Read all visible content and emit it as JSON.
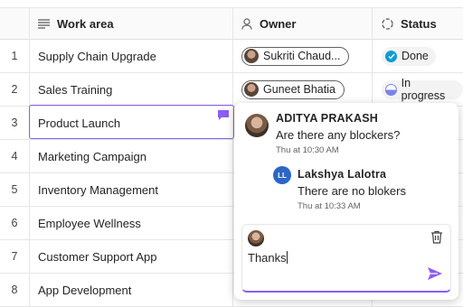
{
  "header": {
    "work_area": "Work area",
    "owner": "Owner",
    "status": "Status"
  },
  "rows": [
    {
      "num": "1",
      "work": "Supply Chain Upgrade",
      "owner": "Sukriti Chaud...",
      "status": "Done"
    },
    {
      "num": "2",
      "work": "Sales Training",
      "owner": "Guneet Bhatia",
      "status": "In progress"
    },
    {
      "num": "3",
      "work": "Product Launch"
    },
    {
      "num": "4",
      "work": "Marketing Campaign"
    },
    {
      "num": "5",
      "work": "Inventory Management"
    },
    {
      "num": "6",
      "work": "Employee Wellness"
    },
    {
      "num": "7",
      "work": "Customer Support App"
    },
    {
      "num": "8",
      "work": "App Development"
    }
  ],
  "comments": [
    {
      "author": "ADITYA PRAKASH",
      "text": "Are there any blockers?",
      "time": "Thu at 10:30 AM"
    },
    {
      "author": "Lakshya Lalotra",
      "initials": "LL",
      "text": "There are no blokers",
      "time": "Thu at 10:33 AM"
    }
  ],
  "composer": {
    "value": "Thanks"
  },
  "colors": {
    "accent": "#8b5cf6",
    "done": "#0f9bd7",
    "progress": "#7b83eb",
    "initials_bg": "#2b66c6"
  },
  "icons": {
    "work_area": "list-lines-icon",
    "owner": "person-icon",
    "status": "dashed-circle-icon",
    "delete": "trash-icon",
    "send": "send-icon",
    "comment": "comment-icon"
  }
}
